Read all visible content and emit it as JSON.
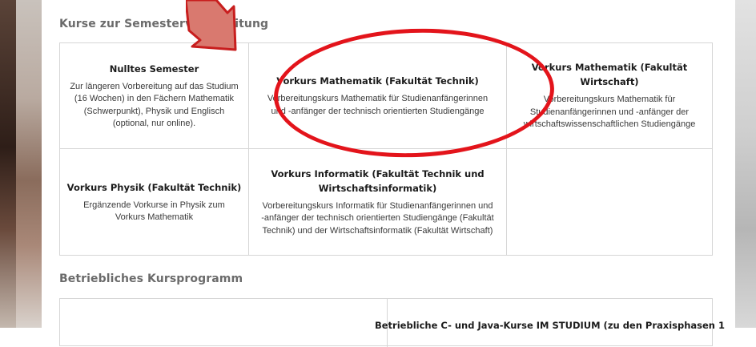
{
  "section1": {
    "title": "Kurse zur Semestervorbereitung",
    "cells": [
      {
        "title": "Nulltes Semester",
        "desc": "Zur längeren Vorbereitung auf das Studium\n(16 Wochen) in den Fächern Mathematik\n(Schwerpunkt), Physik und Englisch\n(optional, nur online)."
      },
      {
        "title": "Vorkurs Mathematik (Fakultät Technik)",
        "desc": "Vorbereitungskurs Mathematik für Studienanfängerinnen\nund -anfänger der technisch orientierten Studiengänge"
      },
      {
        "title": "Vorkurs Mathematik (Fakultät Wirtschaft)",
        "desc": "Vorbereitungskurs Mathematik für\nStudienanfängerinnen und -anfänger der\nwirtschaftswissenschaftlichen Studiengänge"
      },
      {
        "title": "Vorkurs Physik (Fakultät Technik)",
        "desc": "Ergänzende Vorkurse in Physik zum\nVorkurs Mathematik"
      },
      {
        "title": "Vorkurs Informatik (Fakultät Technik und\nWirtschaftsinformatik)",
        "desc": "Vorbereitungskurs Informatik für Studienanfängerinnen und\n-anfänger der technisch orientierten Studiengänge (Fakultät\nTechnik) und der Wirtschaftsinformatik (Fakultät Wirtschaft)"
      }
    ]
  },
  "section2": {
    "title": "Betriebliches Kursprogramm",
    "cells": [
      {
        "title": "Betriebliche C- und Java-Kurse IM STUDIUM (zu den Praxisphasen 1"
      }
    ]
  },
  "annotation": {
    "oval_color": "#e3141b",
    "arrow_color": "#d9796f",
    "arrow_outline": "#c81e1e"
  }
}
